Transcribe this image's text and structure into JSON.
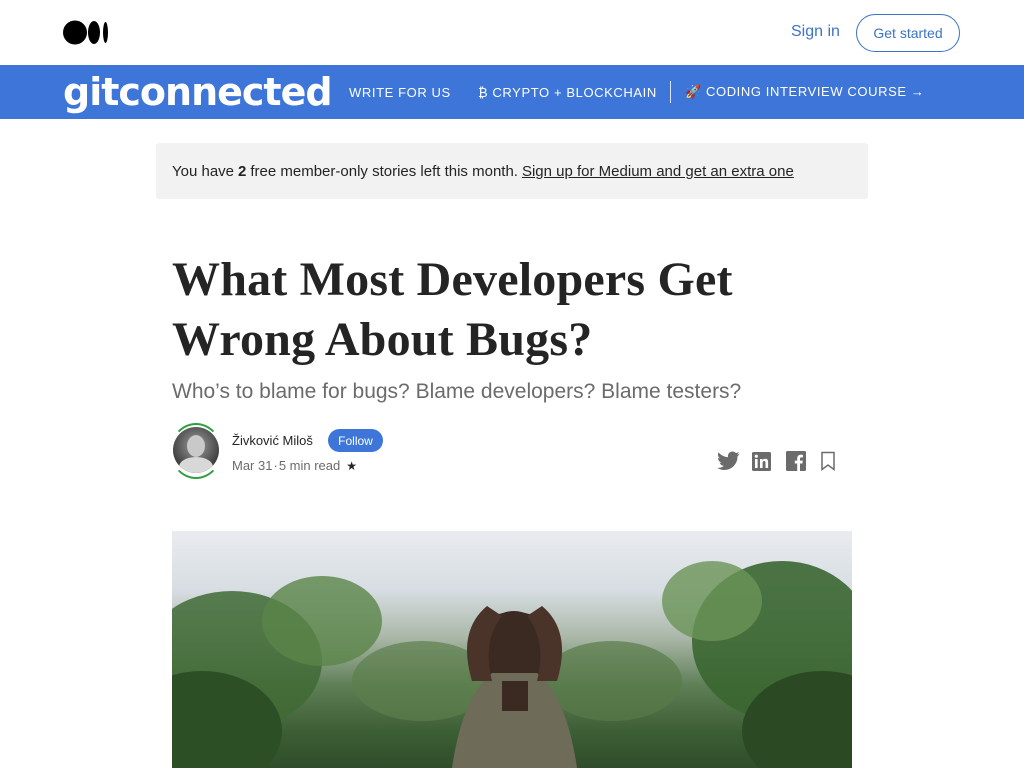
{
  "topbar": {
    "logo_icon": "medium-logo-icon",
    "signin_label": "Sign in",
    "getstarted_label": "Get started"
  },
  "publication": {
    "name": "gitconnected",
    "nav": [
      {
        "label": "WRITE FOR US"
      },
      {
        "label": "₿ CRYPTO + BLOCKCHAIN"
      },
      {
        "label": "🚀 CODING INTERVIEW COURSE →"
      }
    ],
    "color": "#3d75d9"
  },
  "banner": {
    "prefix": "You have",
    "count": "2",
    "suffix": "free member-only stories left this month.",
    "link": "Sign up for Medium and get an extra one"
  },
  "article": {
    "title": "What Most Developers Get Wrong About Bugs?",
    "subtitle": "Who’s to blame for bugs? Blame developers? Blame testers?",
    "author": "Živković Miloš",
    "follow_label": "Follow",
    "date": "Mar 31",
    "separator": "·",
    "read_time": "5 min read",
    "star": "★"
  },
  "share": {
    "icons": [
      "twitter-icon",
      "linkedin-icon",
      "facebook-icon",
      "bookmark-icon"
    ]
  },
  "colors": {
    "link_blue": "#3b73c9",
    "author_ring": "#2f9e44"
  }
}
